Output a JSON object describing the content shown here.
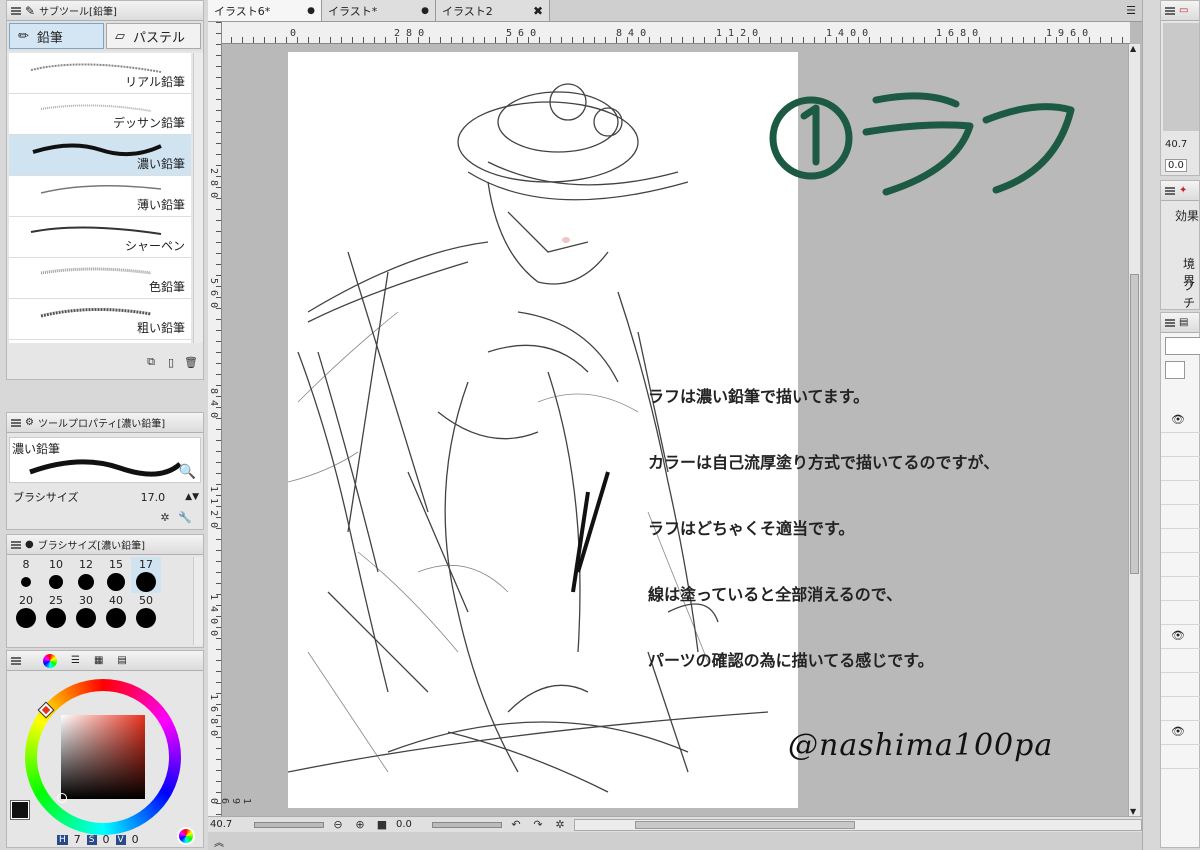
{
  "subtool": {
    "header": "サブツール[鉛筆]",
    "tabs": [
      {
        "label": "鉛筆",
        "active": true
      },
      {
        "label": "パステル",
        "active": false
      }
    ],
    "brushes": [
      {
        "label": "リアル鉛筆"
      },
      {
        "label": "デッサン鉛筆"
      },
      {
        "label": "濃い鉛筆",
        "selected": true
      },
      {
        "label": "薄い鉛筆"
      },
      {
        "label": "シャーペン"
      },
      {
        "label": "色鉛筆"
      },
      {
        "label": "粗い鉛筆"
      }
    ]
  },
  "toolprop": {
    "header": "ツールプロパティ[濃い鉛筆]",
    "brush_name": "濃い鉛筆",
    "size_label": "ブラシサイズ",
    "size_value": "17.0"
  },
  "brushsize": {
    "header": "ブラシサイズ[濃い鉛筆]",
    "row1": [
      "8",
      "10",
      "12",
      "15",
      "17"
    ],
    "row2": [
      "20",
      "25",
      "30",
      "40",
      "50"
    ]
  },
  "color": {
    "h_label": "H",
    "h_value": "7",
    "s_label": "S",
    "s_value": "0",
    "v_label": "V",
    "v_value": "0"
  },
  "tabs": [
    {
      "label": "イラスト6*",
      "active": true
    },
    {
      "label": "イラスト*",
      "active": false
    },
    {
      "label": "イラスト2",
      "active": false
    }
  ],
  "ruler": {
    "h": [
      "0",
      "2 8 0",
      "5 6 0",
      "8 4 0",
      "1 1 2 0",
      "1 4 0 0",
      "1 6 8 0",
      "1 9 6 0"
    ],
    "v": [
      "2 8 0",
      "5 6 0",
      "8 4 0",
      "1 1 2 0",
      "1 4 0 0",
      "1 6 8 0",
      "1 9 6 0"
    ]
  },
  "canvas": {
    "title_art": "①ラフ",
    "note_lines": [
      "ラフは濃い鉛筆で描いてます。",
      "カラーは自己流厚塗り方式で描いてるのですが、",
      "ラフはどちゃくそ適当です。",
      "線は塗っていると全部消えるので、",
      "パーツの確認の為に描いてる感じです。"
    ],
    "signature": "@nashima100pa"
  },
  "statusbar": {
    "zoom": "40.7",
    "angle": "0.0"
  },
  "right": {
    "zoom": "40.7",
    "angle": "0.0",
    "effect_label": "効果",
    "border_label": "境界",
    "fuchi_label": "フチ"
  },
  "colors": {
    "accent_blue": "#cfe3f1",
    "title_green": "#1d5a43"
  }
}
